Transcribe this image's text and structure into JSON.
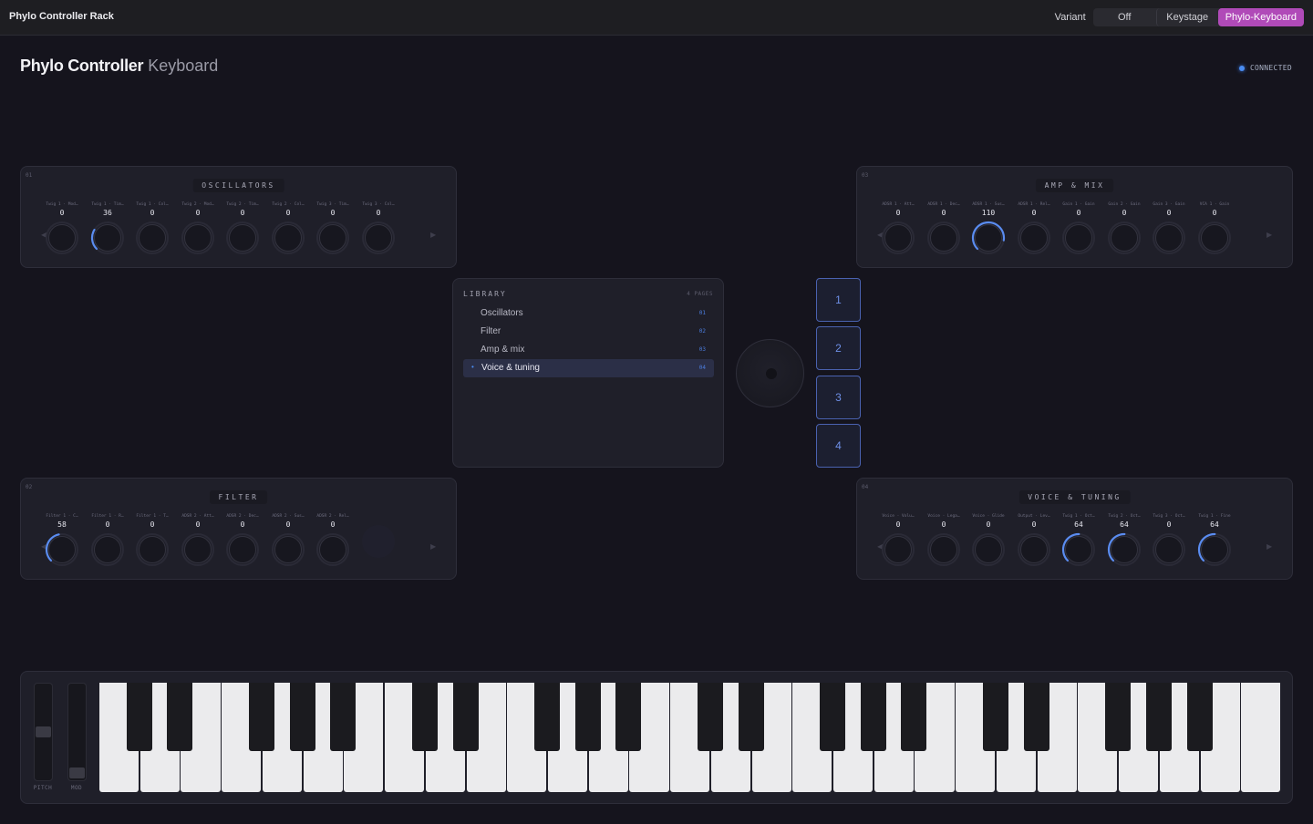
{
  "app": {
    "title": "Phylo Controller Rack"
  },
  "variant": {
    "label": "Variant",
    "options": [
      {
        "label": "Off",
        "active": false
      },
      {
        "label": "Keystage",
        "active": false
      },
      {
        "label": "Phylo-Keyboard",
        "active": true
      }
    ]
  },
  "header": {
    "title": "Phylo Controller",
    "subtitle": "Keyboard",
    "status": "CONNECTED"
  },
  "colors": {
    "accent": "#5a8cf0",
    "variant_active": "#b04ab8"
  },
  "panels": [
    {
      "number": "01",
      "title": "OSCILLATORS",
      "knobs": [
        {
          "label": "Twig 1 · Mod…",
          "value": "0"
        },
        {
          "label": "Twig 1 · Tim…",
          "value": "36"
        },
        {
          "label": "Twig 1 · Col…",
          "value": "0"
        },
        {
          "label": "Twig 2 · Mod…",
          "value": "0"
        },
        {
          "label": "Twig 2 · Tim…",
          "value": "0"
        },
        {
          "label": "Twig 2 · Col…",
          "value": "0"
        },
        {
          "label": "Twig 3 · Tim…",
          "value": "0"
        },
        {
          "label": "Twig 3 · Col…",
          "value": "0"
        }
      ]
    },
    {
      "number": "03",
      "title": "AMP & MIX",
      "knobs": [
        {
          "label": "ADSR 1 · Att…",
          "value": "0"
        },
        {
          "label": "ADSR 1 · Dec…",
          "value": "0"
        },
        {
          "label": "ADSR 1 · Sus…",
          "value": "110"
        },
        {
          "label": "ADSR 1 · Rel…",
          "value": "0"
        },
        {
          "label": "Gain 1 · Gain",
          "value": "0"
        },
        {
          "label": "Gain 2 · Gain",
          "value": "0"
        },
        {
          "label": "Gain 3 · Gain",
          "value": "0"
        },
        {
          "label": "VCA 1 · Gain",
          "value": "0"
        }
      ]
    },
    {
      "number": "02",
      "title": "FILTER",
      "knobs": [
        {
          "label": "Filter 1 · C…",
          "value": "58"
        },
        {
          "label": "Filter 1 · R…",
          "value": "0"
        },
        {
          "label": "Filter 1 · T…",
          "value": "0"
        },
        {
          "label": "ADSR 2 · Att…",
          "value": "0"
        },
        {
          "label": "ADSR 2 · Dec…",
          "value": "0"
        },
        {
          "label": "ADSR 2 · Sus…",
          "value": "0"
        },
        {
          "label": "ADSR 2 · Rel…",
          "value": "0"
        }
      ]
    },
    {
      "number": "04",
      "title": "VOICE & TUNING",
      "knobs": [
        {
          "label": "Voice · Volu…",
          "value": "0"
        },
        {
          "label": "Voice · Lega…",
          "value": "0"
        },
        {
          "label": "Voice · Glide",
          "value": "0"
        },
        {
          "label": "Output · Lev…",
          "value": "0"
        },
        {
          "label": "Twig 1 · Oct…",
          "value": "64"
        },
        {
          "label": "Twig 2 · Oct…",
          "value": "64"
        },
        {
          "label": "Twig 3 · Oct…",
          "value": "0"
        },
        {
          "label": "Twig 1 · Fine",
          "value": "64"
        }
      ]
    }
  ],
  "library": {
    "title": "LIBRARY",
    "pages_label": "4 PAGES",
    "items": [
      {
        "name": "Oscillators",
        "code": "01",
        "active": false
      },
      {
        "name": "Filter",
        "code": "02",
        "active": false
      },
      {
        "name": "Amp & mix",
        "code": "03",
        "active": false
      },
      {
        "name": "Voice & tuning",
        "code": "04",
        "active": true
      }
    ],
    "active_bullet": "•"
  },
  "pads": [
    "1",
    "2",
    "3",
    "4"
  ],
  "keyboard": {
    "pitch_label": "PITCH",
    "mod_label": "MOD",
    "pitch_level": 0.5,
    "mod_level": 0.0,
    "white_keys": 29,
    "black_key_pattern": [
      1,
      1,
      0,
      1,
      1,
      1,
      0
    ]
  },
  "icons": {
    "prev": "◀",
    "next": "▶"
  }
}
